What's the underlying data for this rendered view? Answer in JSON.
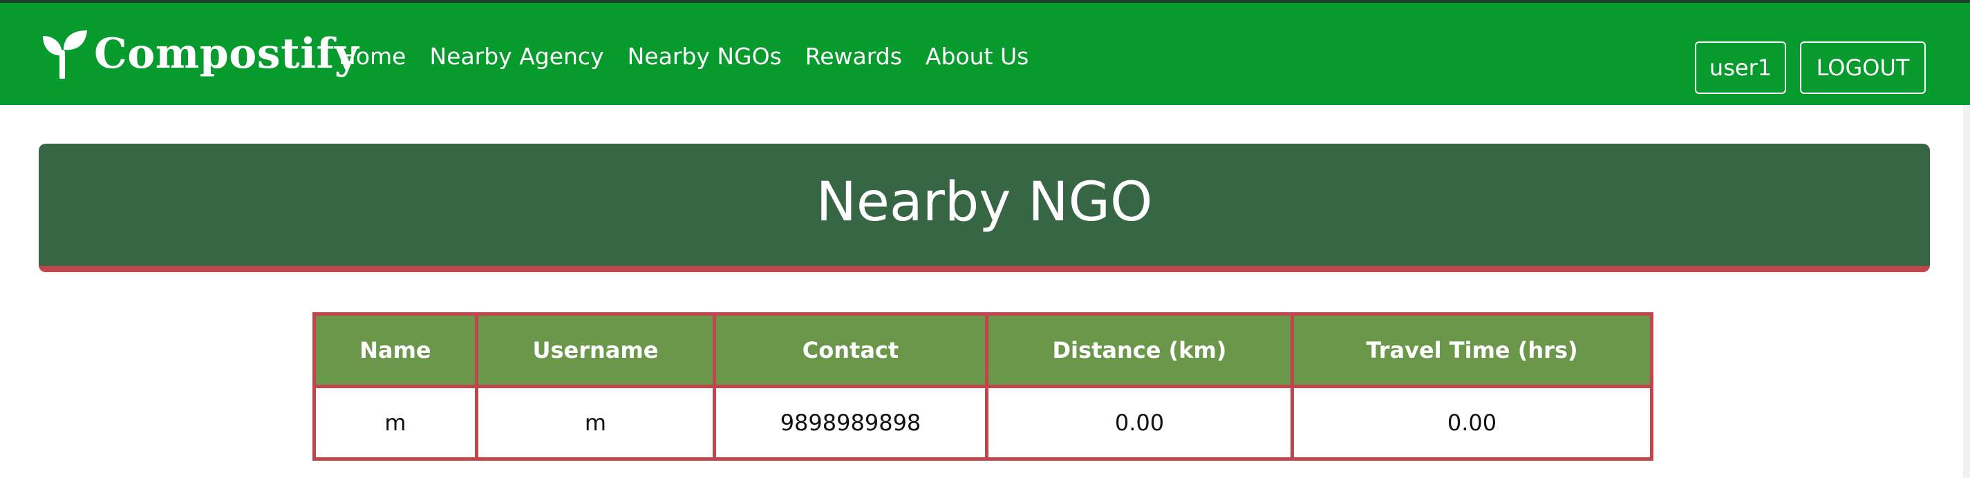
{
  "navbar": {
    "brand": "Compostify",
    "brand_icon": "sprout-icon",
    "links": [
      "Home",
      "Nearby Agency",
      "Nearby NGOs",
      "Rewards",
      "About Us"
    ],
    "user_label": "user1",
    "logout_label": "LOGOUT"
  },
  "page": {
    "title": "Nearby NGO"
  },
  "table": {
    "headers": [
      "Name",
      "Username",
      "Contact",
      "Distance (km)",
      "Travel Time (hrs)"
    ],
    "rows": [
      [
        "m",
        "m",
        "9898989898",
        "0.00",
        "0.00"
      ]
    ]
  },
  "colors": {
    "navbar": "#079b2d",
    "banner": "#376644",
    "accent_border": "#c0454d",
    "table_header": "#6a974a"
  }
}
